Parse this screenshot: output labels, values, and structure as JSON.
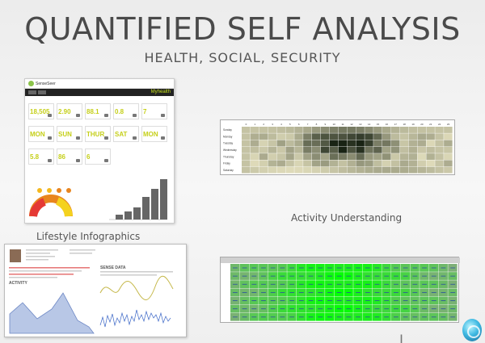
{
  "slide": {
    "title": "QUANTIFIED SELF ANALYSIS",
    "subtitle": "HEALTH, SOCIAL, SECURITY",
    "caption_left": "Lifestyle  Infographics",
    "caption_right": "Activity Understanding",
    "footer_fragment": "l"
  },
  "dashboard": {
    "logo": "SenseSeer",
    "brand": "Myhealth",
    "tiles": [
      "18,505",
      "2.90",
      "88.1",
      "0.8",
      "7",
      "MON",
      "SUN",
      "THUR",
      "SAT",
      "MON",
      "5.8",
      "86",
      "6"
    ],
    "bars": [
      0.12,
      0.2,
      0.3,
      0.55,
      0.75,
      1.0
    ],
    "accent": "#c5cf18"
  },
  "activity_report": {
    "heading_left": "ACTIVITY",
    "heading_right": "SENSE DATA"
  },
  "heatmap_top": {
    "columns": [
      "0",
      "1",
      "2",
      "3",
      "4",
      "5",
      "6",
      "7",
      "8",
      "9",
      "10",
      "11",
      "12",
      "13",
      "14",
      "15",
      "16",
      "17",
      "18",
      "19",
      "20",
      "21",
      "22",
      "23"
    ],
    "rows": [
      "Sunday",
      "Monday",
      "Tuesday",
      "Wednesday",
      "Thursday",
      "Friday",
      "Saturday"
    ]
  },
  "heatmap_bottom": {
    "rows": 7,
    "columns": 24
  }
}
